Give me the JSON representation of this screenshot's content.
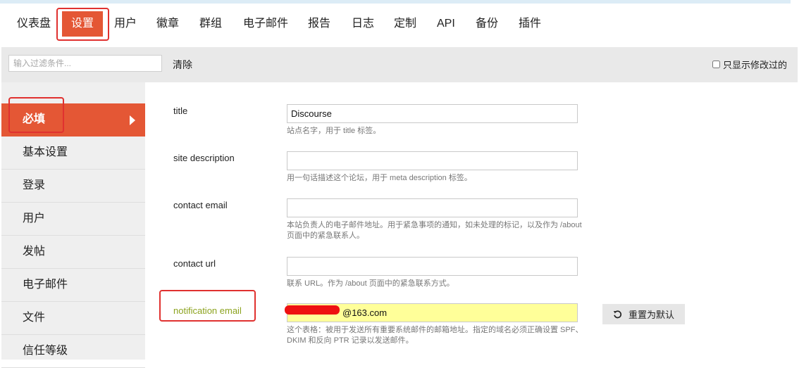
{
  "nav": {
    "items": [
      "仪表盘",
      "设置",
      "用户",
      "徽章",
      "群组",
      "电子邮件",
      "报告",
      "日志",
      "定制",
      "API",
      "备份",
      "插件"
    ]
  },
  "filter": {
    "placeholder": "输入过滤条件...",
    "clear_label": "清除",
    "only_modified_label": "只显示修改过的"
  },
  "sidebar": {
    "items": [
      "必填",
      "基本设置",
      "登录",
      "用户",
      "发帖",
      "电子邮件",
      "文件",
      "信任等级"
    ]
  },
  "settings": [
    {
      "label": "title",
      "value": "Discourse",
      "description": "站点名字，用于 title 标签。"
    },
    {
      "label": "site description",
      "value": "",
      "description": "用一句话描述这个论坛，用于 meta description 标签。"
    },
    {
      "label": "contact email",
      "value": "",
      "description": "本站负责人的电子邮件地址。用于紧急事项的通知，如未处理的标记，以及作为 /about 页面中的紧急联系人。"
    },
    {
      "label": "contact url",
      "value": "",
      "description": "联系 URL。作为 /about 页面中的紧急联系方式。"
    },
    {
      "label": "notification email",
      "value": "@163.com",
      "description": "这个表格：被用于发送所有重要系统邮件的邮箱地址。指定的域名必须正确设置 SPF、DKIM 和反向 PTR 记录以发送邮件。",
      "reset_label": "重置为默认"
    }
  ],
  "colors": {
    "accent": "#e45735",
    "modified_label": "#8ca31f",
    "modified_field": "#ffff99",
    "annotation_box": "#e0312f"
  }
}
